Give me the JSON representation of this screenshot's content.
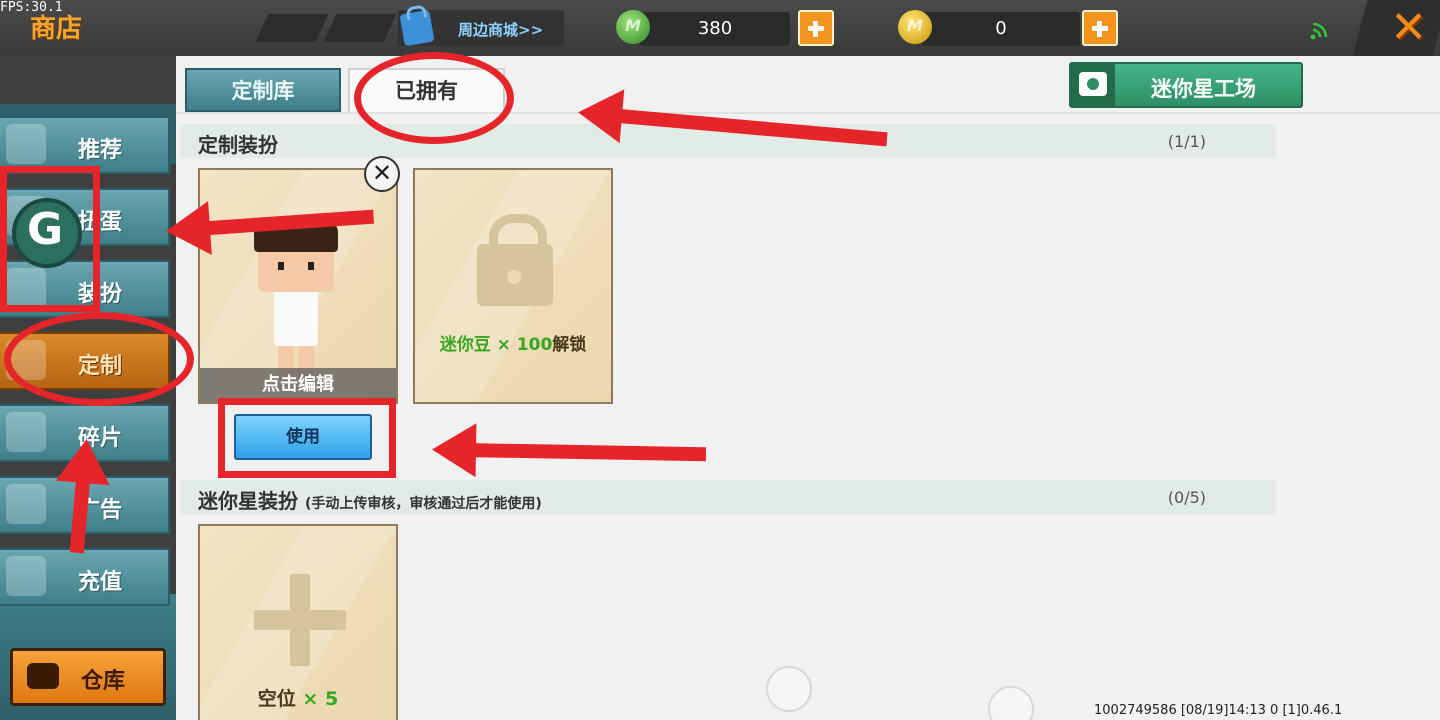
{
  "status": {
    "fps": "FPS:30.1"
  },
  "header": {
    "title": "商店",
    "merch_label": "周边商城>>",
    "mini_beans": "380",
    "mini_coins": "0",
    "coin_gem_letter": "M",
    "coin_gold_letter": "M"
  },
  "sidebar": {
    "items": [
      {
        "label": "推荐"
      },
      {
        "label": "扭蛋"
      },
      {
        "label": "装扮"
      },
      {
        "label": "定制"
      },
      {
        "label": "碎片"
      },
      {
        "label": "广告"
      },
      {
        "label": "充值"
      }
    ],
    "warehouse_label": "仓库"
  },
  "tabs": {
    "library": "定制库",
    "owned": "已拥有",
    "factory": "迷你星工场"
  },
  "custom_section": {
    "title": "定制装扮",
    "count": "(1/1)",
    "edit_label": "点击编辑",
    "use_label": "使用",
    "remove_glyph": "✕",
    "unlock_currency": "迷你豆 × 100",
    "unlock_suffix": "解锁"
  },
  "star_section": {
    "title": "迷你星装扮",
    "note": "(手动上传审核，审核通过后才能使用)",
    "count": "(0/5)",
    "empty_label": "空位",
    "empty_count": " × 5"
  },
  "footer": {
    "info": "1002749586   [08/19]14:13 0    [1]0.46.1"
  },
  "annotations": {
    "badge_letter": "G"
  },
  "colors": {
    "accent_orange": "#f5931f",
    "teal": "#3f7f8a",
    "annotation_red": "#e6252b",
    "unlock_green": "#36a81e"
  },
  "icons": [
    "merch-bag-icon",
    "mini-bean-icon",
    "mini-coin-icon",
    "plus-icon",
    "signal-icon",
    "close-icon",
    "camera-icon",
    "chest-icon",
    "lock-icon",
    "add-slot-icon",
    "remove-icon"
  ]
}
